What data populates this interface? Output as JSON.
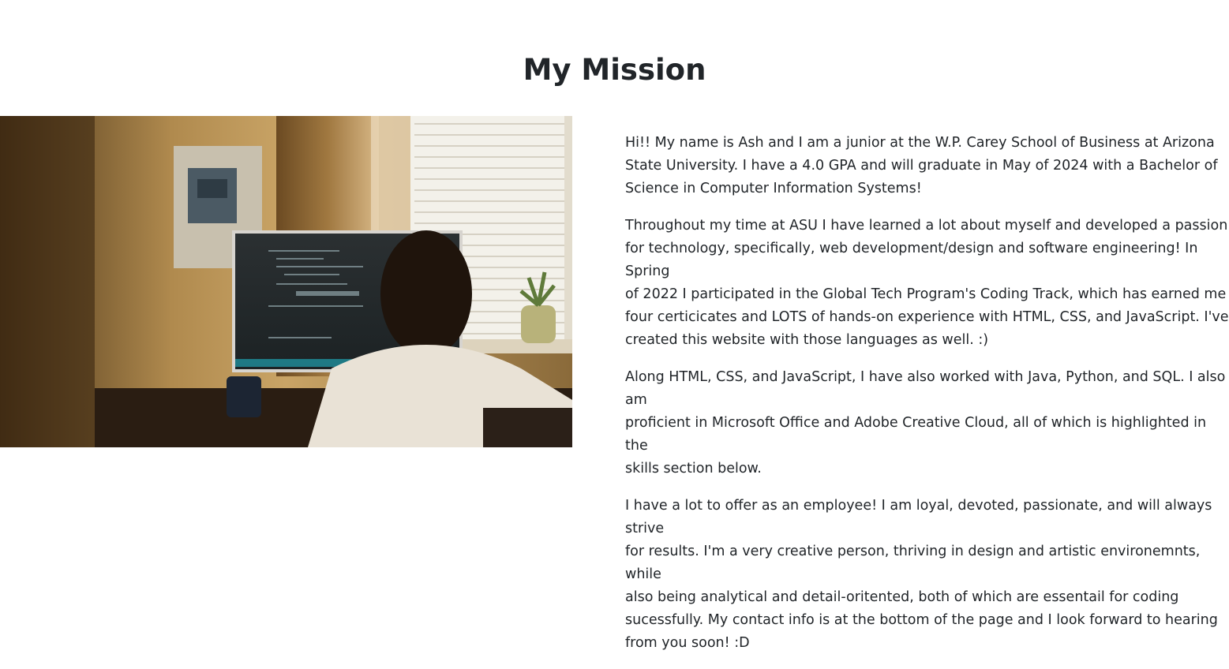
{
  "section": {
    "title": "My Mission"
  },
  "photo": {
    "subject": "person-coding-at-desktop-computer"
  },
  "paragraphs": [
    "Hi!! My name is Ash and I am a junior at the W.P. Carey School of Business at Arizona\nState University. I have a 4.0 GPA and will graduate in May of 2024 with a Bachelor of\nScience in Computer Information Systems!",
    "Throughout my time at ASU I have learned a lot about myself and developed a passion\nfor technology, specifically, web development/design and software engineering! In Spring\nof 2022 I participated in the Global Tech Program's Coding Track, which has earned me\nfour certicicates and LOTS of hands-on experience with HTML, CSS, and JavaScript. I've\ncreated this website with those languages as well. :)",
    "Along HTML, CSS, and JavaScript, I have also worked with Java, Python, and SQL. I also am\nproficient in Microsoft Office and Adobe Creative Cloud, all of which is highlighted in the\nskills section below.",
    "I have a lot to offer as an employee! I am loyal, devoted, passionate, and will always strive\nfor results. I'm a very creative person, thriving in design and artistic environemnts, while\nalso being analytical and detail-oritented, both of which are essentail for coding\nsucessfully. My contact info is at the bottom of the page and I look forward to hearing\nfrom you soon! :D"
  ]
}
